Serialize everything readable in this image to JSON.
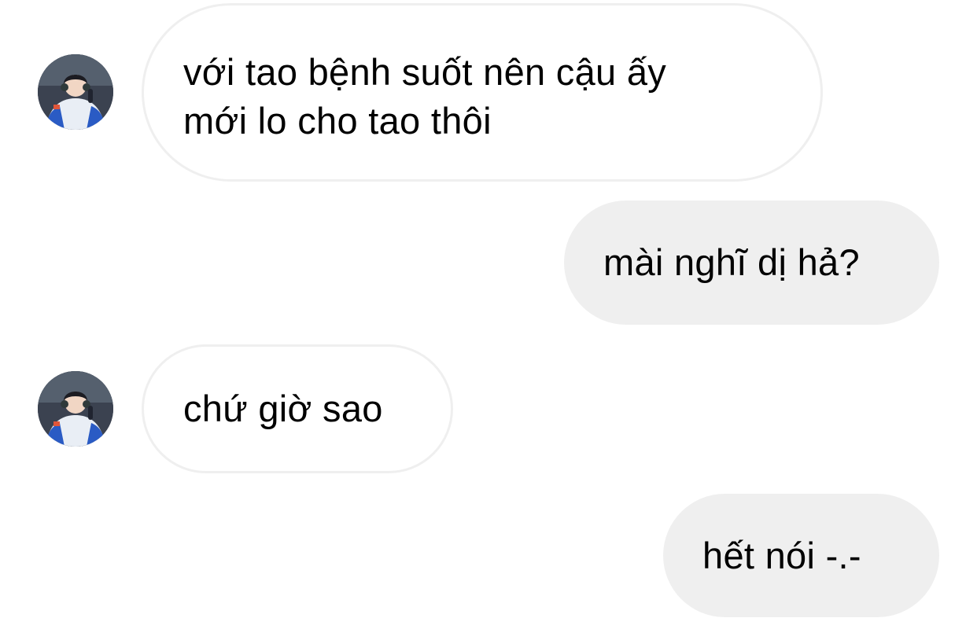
{
  "messages": [
    {
      "direction": "incoming",
      "lines": [
        "với tao bệnh suốt nên cậu ấy",
        "mới lo cho tao thôi"
      ],
      "show_avatar": true
    },
    {
      "direction": "outgoing",
      "lines": [
        "mài nghĩ dị hả?"
      ]
    },
    {
      "direction": "incoming",
      "lines": [
        "chứ giờ sao"
      ],
      "show_avatar": true
    },
    {
      "direction": "outgoing",
      "lines": [
        "hết nói -.-"
      ]
    }
  ],
  "colors": {
    "background": "#ffffff",
    "incoming_bubble": "#ffffff",
    "incoming_border": "#efefef",
    "outgoing_bubble": "#efefef",
    "text": "#000000"
  },
  "icons": {
    "avatar": "contact-avatar-photo"
  }
}
